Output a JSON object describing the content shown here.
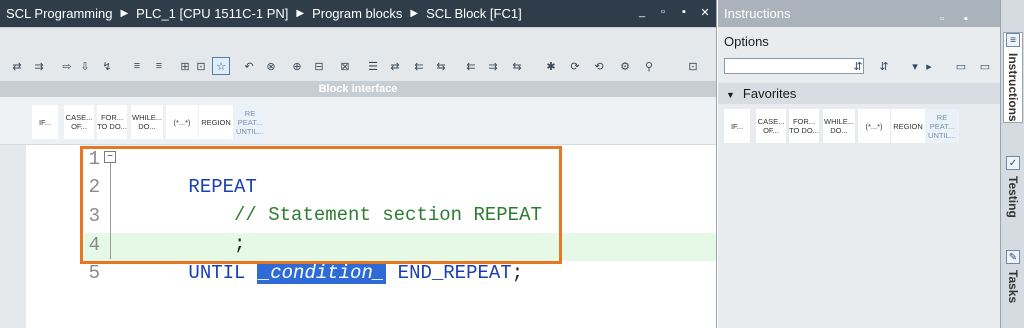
{
  "breadcrumb": {
    "items": [
      "SCL Programming",
      "PLC_1 [CPU 1511C-1 PN]",
      "Program blocks",
      "SCL Block [FC1]"
    ],
    "sep": "▶"
  },
  "window_controls": [
    "_",
    "▫",
    "▪",
    "✕"
  ],
  "toolbar": {
    "icons": [
      "⇄",
      "⇉",
      "⇨",
      "⇩",
      "↯",
      "≡",
      "≡",
      "⊞",
      "⊡",
      "☆",
      "↶",
      "⊗",
      "⊕",
      "⊟",
      "⊠",
      "☰",
      "⇄",
      "⇇",
      "⇆",
      "⇇",
      "⇉",
      "⇆",
      "✱",
      "⟳",
      "⟲",
      "⚙",
      "⚲",
      "⊡"
    ]
  },
  "block_interface": {
    "label": "Block interface"
  },
  "instruction_strip": {
    "buttons": [
      {
        "label": "IF...",
        "dim": false
      },
      {
        "label": "CASE... OF...",
        "dim": false
      },
      {
        "label": "FOR... TO DO...",
        "dim": false
      },
      {
        "label": "WHILE... DO...",
        "dim": false
      },
      {
        "label": "(*...*)",
        "dim": false
      },
      {
        "label": "REGION",
        "dim": false
      },
      {
        "label": "RE PEAT... UNTIL...",
        "dim": true
      }
    ]
  },
  "code": {
    "line_numbers": [
      "1",
      "2",
      "3",
      "4",
      "5"
    ],
    "fold_symbol": "−",
    "line1": {
      "kw": "REPEAT"
    },
    "line2": {
      "comment": "// Statement section REPEAT"
    },
    "line3": {
      "text": ";"
    },
    "line4": {
      "kw1": "UNTIL",
      "condition": "_condition_",
      "kw2": "END_REPEAT",
      "end": ";"
    }
  },
  "instructions": {
    "title": "Instructions",
    "controls": [
      "▫",
      "▪"
    ],
    "options_label": "Options",
    "search_value": "",
    "options_icons": [
      "⇵",
      "⇵",
      "▾",
      "▸",
      "▭",
      "▭"
    ],
    "favorites_label": "Favorites",
    "favorites_triangle": "▼"
  },
  "task_cards": [
    {
      "label": "Instructions",
      "icon": "≡",
      "active": true
    },
    {
      "label": "Testing",
      "icon": "✓",
      "active": false
    },
    {
      "label": "Tasks",
      "icon": "✎",
      "active": false
    }
  ]
}
